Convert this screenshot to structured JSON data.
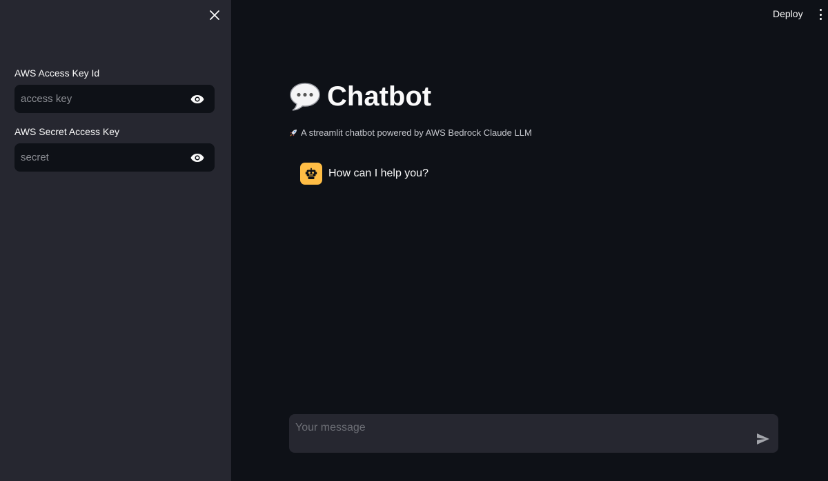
{
  "sidebar": {
    "close_icon": "close-icon",
    "fields": [
      {
        "label": "AWS Access Key Id",
        "placeholder": "access key",
        "value": ""
      },
      {
        "label": "AWS Secret Access Key",
        "placeholder": "secret",
        "value": ""
      }
    ],
    "eye_icon": "eye-icon"
  },
  "header": {
    "deploy_label": "Deploy",
    "menu_icon": "vertical-dots-icon"
  },
  "main": {
    "title_emoji": "💬",
    "title": "Chatbot",
    "caption_emoji": "🚀",
    "caption": "A streamlit chatbot powered by AWS Bedrock Claude LLM",
    "messages": [
      {
        "role": "assistant",
        "avatar_icon": "robot-icon",
        "text": "How can I help you?"
      }
    ],
    "chat_input": {
      "placeholder": "Your message",
      "send_icon": "send-icon"
    }
  },
  "colors": {
    "background": "#0e1117",
    "sidebar": "#262730",
    "assistant_avatar": "#ffbd45",
    "text": "#fafafa"
  }
}
